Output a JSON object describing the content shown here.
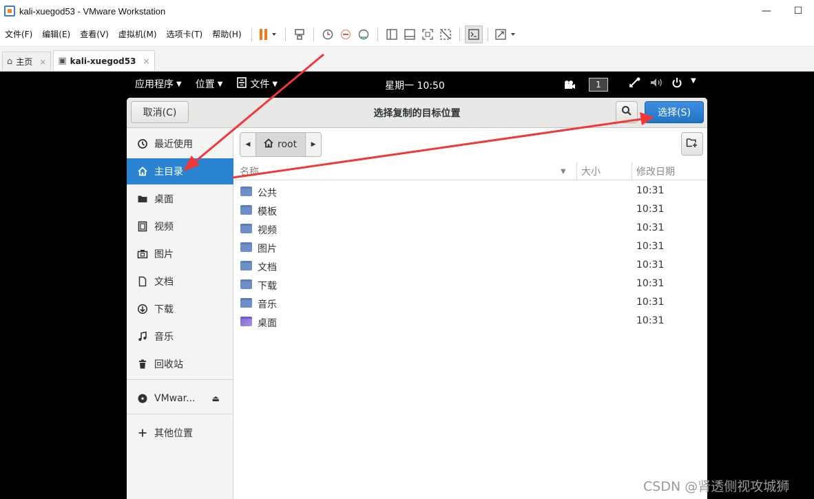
{
  "window": {
    "title": "kali-xuegod53 - VMware Workstation",
    "minimize": "—",
    "maximize": "☐"
  },
  "menu": {
    "items": [
      "文件(F)",
      "编辑(E)",
      "查看(V)",
      "虚拟机(M)",
      "选项卡(T)",
      "帮助(H)"
    ]
  },
  "tabs": [
    {
      "icon": "⌂",
      "label": "主页",
      "close": "×"
    },
    {
      "icon": "▣",
      "label": "kali-xuegod53",
      "close": "×"
    }
  ],
  "guest_topbar": {
    "apps": "应用程序",
    "places": "位置",
    "files": "文件",
    "clock": "星期一 10:50",
    "workspace": "1"
  },
  "dialog": {
    "cancel": "取消(C)",
    "title": "选择复制的目标位置",
    "select": "选择(S)",
    "path_root": "root"
  },
  "sidebar": [
    {
      "icon": "recent-icon",
      "label": "最近使用"
    },
    {
      "icon": "home-icon",
      "label": "主目录"
    },
    {
      "icon": "folder-icon",
      "label": "桌面"
    },
    {
      "icon": "video-icon",
      "label": "视频"
    },
    {
      "icon": "picture-icon",
      "label": "图片"
    },
    {
      "icon": "document-icon",
      "label": "文档"
    },
    {
      "icon": "download-icon",
      "label": "下载"
    },
    {
      "icon": "music-icon",
      "label": "音乐"
    },
    {
      "icon": "trash-icon",
      "label": "回收站"
    },
    {
      "icon": "disc-icon",
      "label": "VMwar..."
    },
    {
      "icon": "plus-icon",
      "label": "其他位置"
    }
  ],
  "columns": {
    "name": "名称",
    "size": "大小",
    "modified": "修改日期"
  },
  "files": [
    {
      "name": "公共",
      "time": "10:31"
    },
    {
      "name": "模板",
      "time": "10:31"
    },
    {
      "name": "视频",
      "time": "10:31"
    },
    {
      "name": "图片",
      "time": "10:31"
    },
    {
      "name": "文档",
      "time": "10:31"
    },
    {
      "name": "下载",
      "time": "10:31"
    },
    {
      "name": "音乐",
      "time": "10:31"
    },
    {
      "name": "桌面",
      "time": "10:31"
    }
  ],
  "watermark": "CSDN @肾透侧视攻城狮",
  "colors": {
    "select_blue": "#2a84d2",
    "annotation_red": "#f0383a"
  }
}
